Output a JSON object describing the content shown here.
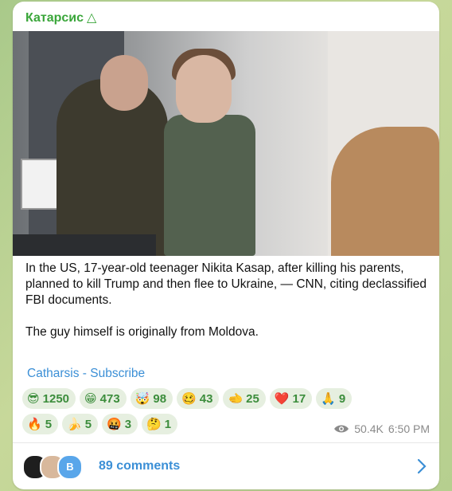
{
  "post": {
    "channel_name": "Катарсис",
    "channel_badge": "△",
    "paragraph1": "In the US, 17-year-old teenager Nikita Kasap, after killing his parents, planned to kill Trump and then flee to Ukraine, — CNN, citing declassified FBI documents.",
    "paragraph2": "The guy himself is originally from Moldova.",
    "subscribe_link": "Catharsis - Subscribe",
    "views": "50.4K",
    "time": "6:50 PM"
  },
  "reactions": [
    {
      "emoji": "😎",
      "count": "1250"
    },
    {
      "emoji": "😁",
      "count": "473"
    },
    {
      "emoji": "🤯",
      "count": "98"
    },
    {
      "emoji": "🥴",
      "count": "43"
    },
    {
      "emoji": "🫲",
      "count": "25"
    },
    {
      "emoji": "❤️",
      "count": "17"
    },
    {
      "emoji": "🙏",
      "count": "9"
    },
    {
      "emoji": "🔥",
      "count": "5"
    },
    {
      "emoji": "🍌",
      "count": "5"
    },
    {
      "emoji": "🤬",
      "count": "3"
    },
    {
      "emoji": "🤔",
      "count": "1"
    }
  ],
  "comments": {
    "label": "89 comments",
    "avatar3_letter": "B"
  },
  "colors": {
    "accent_green": "#3aa63a",
    "link_blue": "#3b8fd6"
  }
}
